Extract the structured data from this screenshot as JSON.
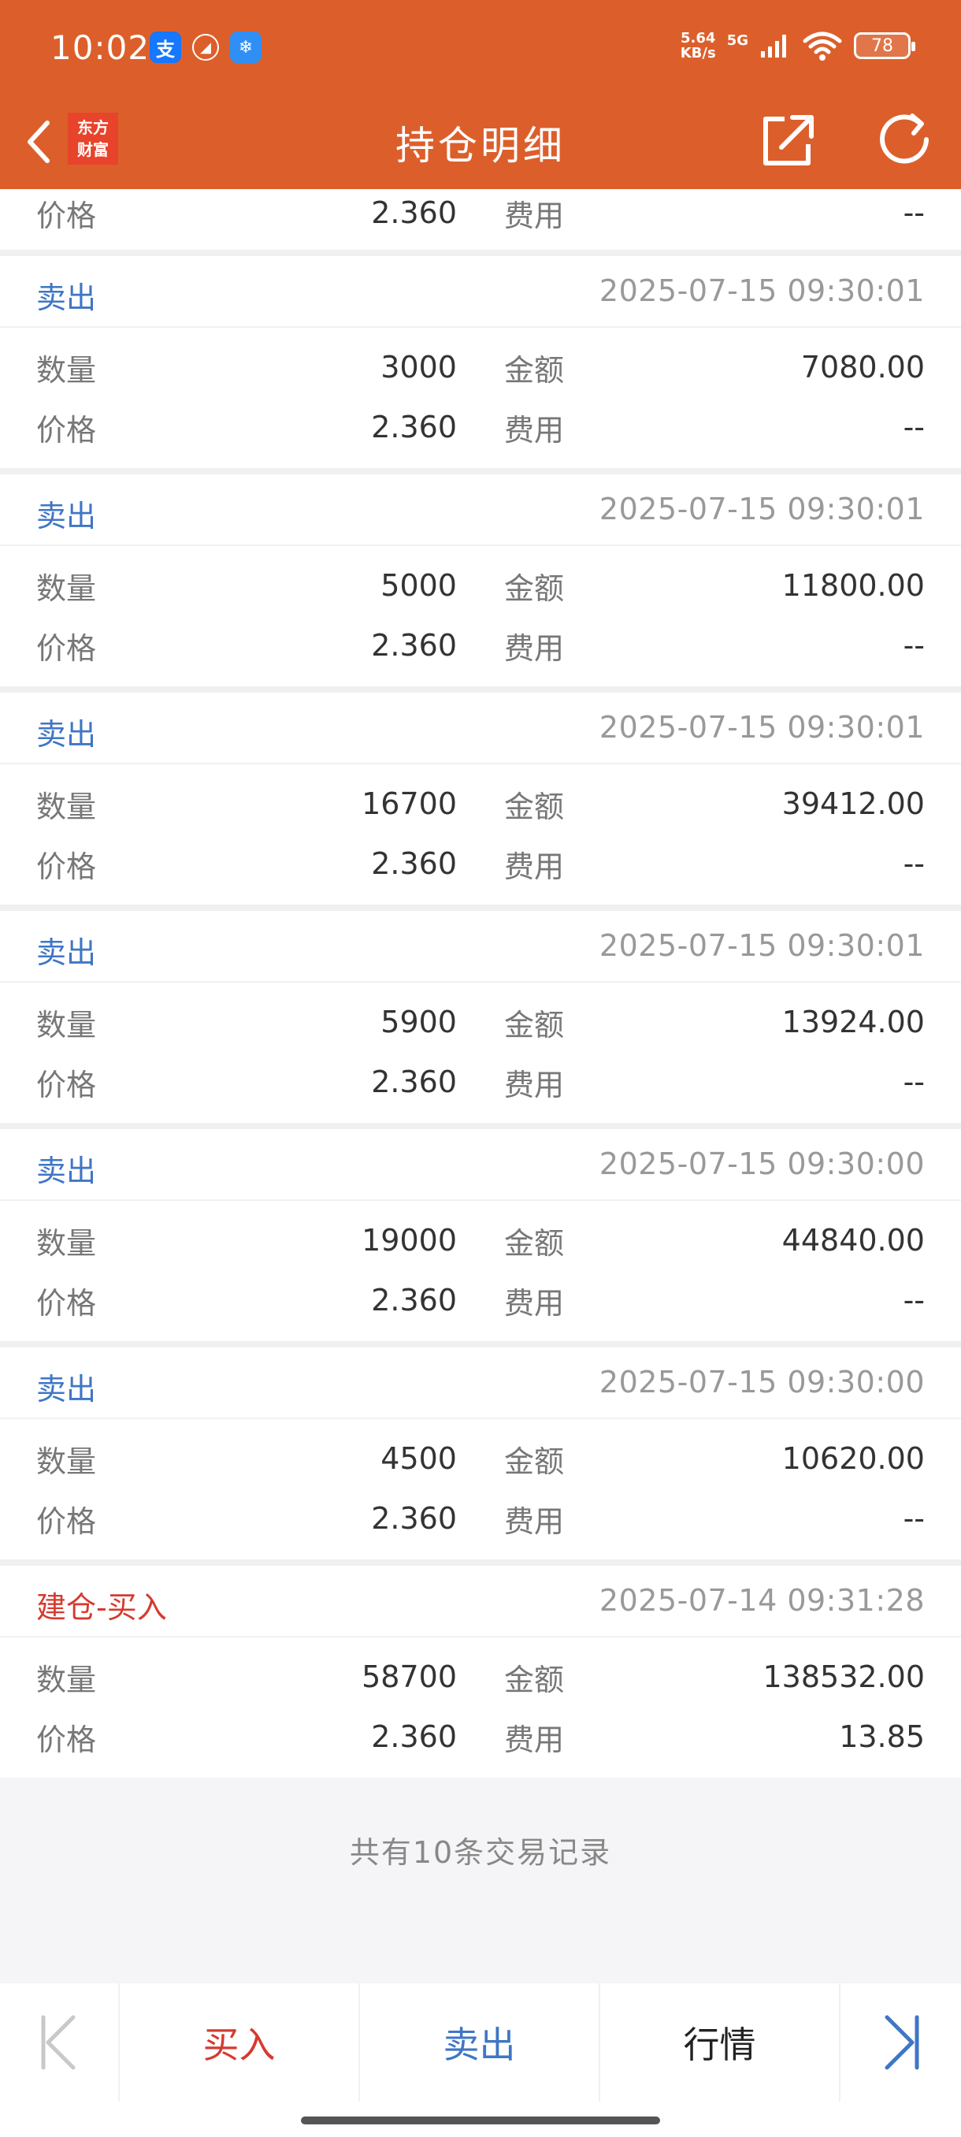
{
  "status_bar": {
    "time": "10:02",
    "speed_value": "5.64",
    "speed_unit": "KB/s",
    "network": "5G",
    "battery": "78"
  },
  "nav": {
    "logo_line1": "东方",
    "logo_line2": "财富",
    "title": "持仓明细"
  },
  "labels": {
    "quantity": "数量",
    "amount": "金额",
    "price": "价格",
    "fee": "费用"
  },
  "partial_row": {
    "price": "2.360",
    "fee": "--"
  },
  "records": [
    {
      "type": "卖出",
      "time": "2025-07-15 09:30:01",
      "quantity": "3000",
      "amount": "7080.00",
      "price": "2.360",
      "fee": "--"
    },
    {
      "type": "卖出",
      "time": "2025-07-15 09:30:01",
      "quantity": "5000",
      "amount": "11800.00",
      "price": "2.360",
      "fee": "--"
    },
    {
      "type": "卖出",
      "time": "2025-07-15 09:30:01",
      "quantity": "16700",
      "amount": "39412.00",
      "price": "2.360",
      "fee": "--"
    },
    {
      "type": "卖出",
      "time": "2025-07-15 09:30:01",
      "quantity": "5900",
      "amount": "13924.00",
      "price": "2.360",
      "fee": "--"
    },
    {
      "type": "卖出",
      "time": "2025-07-15 09:30:00",
      "quantity": "19000",
      "amount": "44840.00",
      "price": "2.360",
      "fee": "--"
    },
    {
      "type": "卖出",
      "time": "2025-07-15 09:30:00",
      "quantity": "4500",
      "amount": "10620.00",
      "price": "2.360",
      "fee": "--"
    },
    {
      "type": "建仓-买入",
      "time": "2025-07-14 09:31:28",
      "quantity": "58700",
      "amount": "138532.00",
      "price": "2.360",
      "fee": "13.85"
    }
  ],
  "summary": "共有10条交易记录",
  "bottom_bar": {
    "buy": "买入",
    "sell": "卖出",
    "market": "行情"
  },
  "colors": {
    "header": "#dc5f2b",
    "sell": "#3f76c5",
    "buy": "#d63a2f"
  }
}
